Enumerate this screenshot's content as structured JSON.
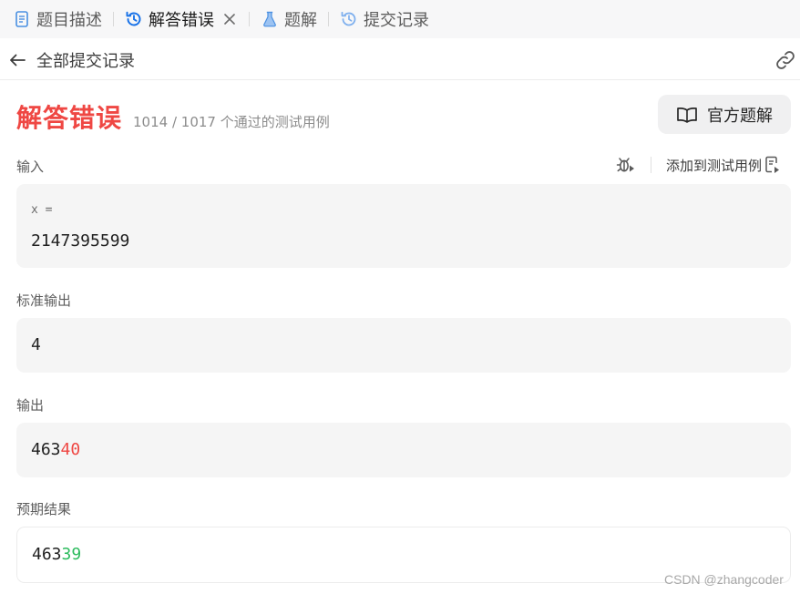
{
  "tabs": [
    {
      "label": "题目描述",
      "icon": "document-icon"
    },
    {
      "label": "解答错误",
      "icon": "history-icon",
      "active": true
    },
    {
      "label": "题解",
      "icon": "flask-icon"
    },
    {
      "label": "提交记录",
      "icon": "history-icon"
    }
  ],
  "back_bar": {
    "title": "全部提交记录",
    "back_icon": "arrow-left-icon",
    "link_icon": "link-icon"
  },
  "result": {
    "status": "解答错误",
    "count": "1014 / 1017 个通过的测试用例",
    "status_color": "#ef4743"
  },
  "official_solution": {
    "label": "官方题解",
    "icon": "book-icon"
  },
  "input": {
    "label": "输入",
    "var_name": "x =",
    "value": "2147395599"
  },
  "toolbar": {
    "add_label": "添加到测试用例",
    "debug_icon": "bug-play-icon",
    "add_icon": "add-testcase-icon"
  },
  "stdout": {
    "label": "标准输出",
    "value": "4"
  },
  "output": {
    "label": "输出",
    "value_prefix": "463",
    "value_diff": "40"
  },
  "expected": {
    "label": "预期结果",
    "value_prefix": "463",
    "value_diff": "39"
  },
  "watermark": "CSDN @zhangcoder",
  "colors": {
    "error": "#ef4743",
    "success": "#2cbb5d",
    "accent_blue": "#1890ff"
  }
}
